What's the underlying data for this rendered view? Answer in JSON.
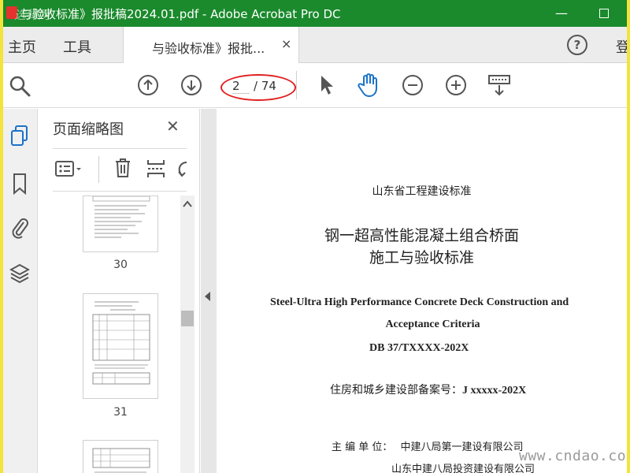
{
  "window": {
    "title": "与验收标准》报批稿2024.01.pdf - Adobe Acrobat Pro DC",
    "watermark": "选择网",
    "minimize_glyph": "—"
  },
  "tabs": {
    "home": "主页",
    "tools": "工具",
    "document": "与验收标准》报批...",
    "close_glyph": "×",
    "help_glyph": "?",
    "sign_in": "登"
  },
  "toolbar": {
    "page_current": "2",
    "page_total": "/ 74",
    "icons": [
      "zoom-search-icon",
      "prev-page-icon",
      "next-page-icon",
      "select-arrow-icon",
      "hand-tool-icon",
      "zoom-out-icon",
      "zoom-in-icon",
      "scroll-mode-icon"
    ]
  },
  "left_rail": {
    "icons": [
      "page-thumbnails-icon",
      "bookmarks-icon",
      "attachments-icon",
      "layers-icon"
    ]
  },
  "thumbnail_panel": {
    "title": "页面缩略图",
    "close_glyph": "✕",
    "pages": [
      {
        "label": "30"
      },
      {
        "label": "31"
      }
    ]
  },
  "document": {
    "standard_header": "山东省工程建设标准",
    "title_cn_line1": "钢一超高性能混凝土组合桥面",
    "title_cn_line2": "施工与验收标准",
    "title_en_line1": "Steel-Ultra  High  Performance  Concrete  Deck  Construction  and",
    "title_en_line2": "Acceptance Criteria",
    "code": "DB 37/TXXXX-202X",
    "record_label": "住房和城乡建设部备案号：",
    "record_value": "J xxxxx-202X",
    "editor_label": "主 编 单 位：",
    "editor_unit1": "中建八局第一建设有限公司",
    "editor_unit2": "山东中建八局投资建设有限公司"
  },
  "site_watermark": "www.cndao.com",
  "colors": {
    "titlebar": "#1a8a2c",
    "outer_border": "#f4e33a",
    "annotation_ellipse": "#e02020",
    "hand_tool": "#1b73c8",
    "left_rail_active": "#1b73c8"
  }
}
